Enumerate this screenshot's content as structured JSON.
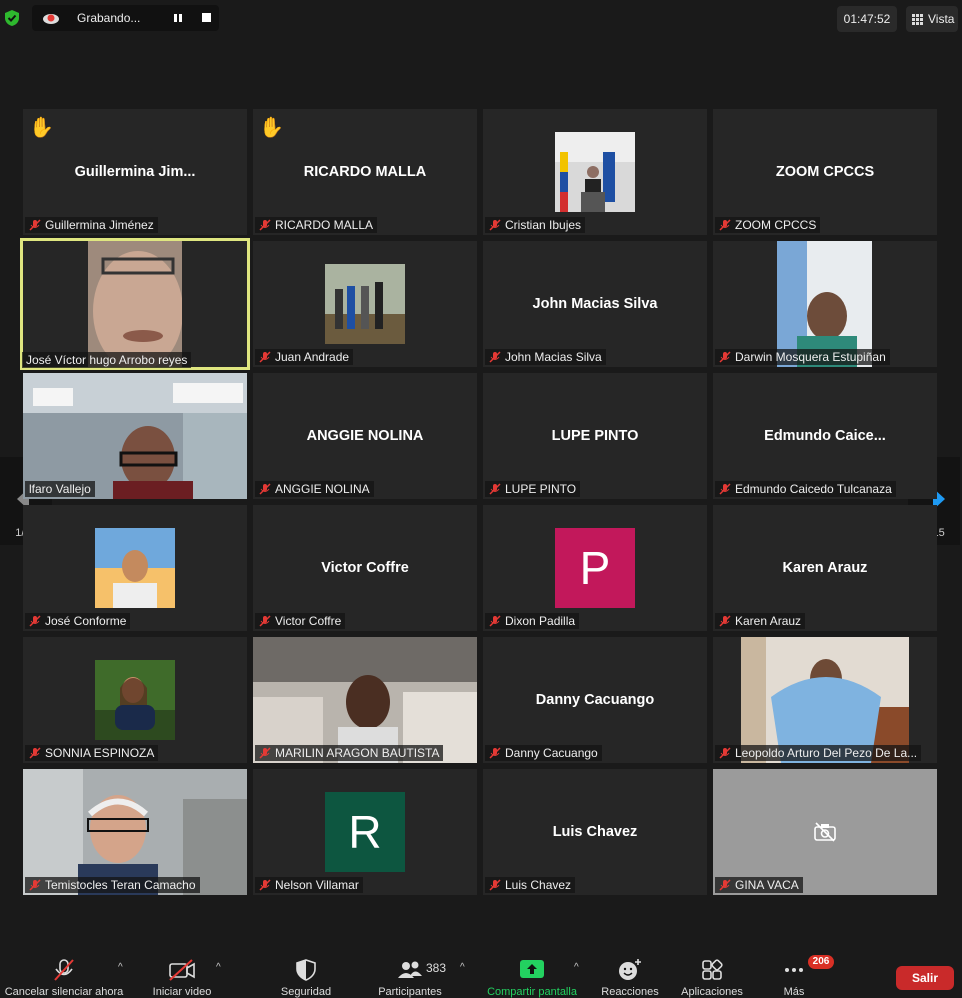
{
  "topbar": {
    "recording_label": "Grabando...",
    "timer": "01:47:52",
    "view_label": "Vista"
  },
  "colors": {
    "active_speaker_border": "#dfe680",
    "avatar_p": "#c2185b",
    "avatar_r": "#0d5640",
    "leave_button": "#c92a2a",
    "share_green": "#23d160",
    "pager_arrow": "#1e9af3"
  },
  "pager": {
    "left_page": "1/15",
    "right_page": "1/15"
  },
  "participants": [
    {
      "name": "Guillermina Jiménez",
      "display": "Guillermina  Jim...",
      "hand": true
    },
    {
      "name": "RICARDO MALLA",
      "display": "RICARDO MALLA",
      "hand": true
    },
    {
      "name": "Cristian Ibujes"
    },
    {
      "name": "ZOOM CPCCS",
      "display": "ZOOM CPCCS"
    },
    {
      "name": "José Víctor hugo Arrobo reyes"
    },
    {
      "name": "Juan Andrade"
    },
    {
      "name": "John Macias Silva",
      "display": "John Macias Silva"
    },
    {
      "name": "Darwin Mosquera Estupiñan"
    },
    {
      "name": "lfaro Vallejo"
    },
    {
      "name": "ANGGIE NOLINA",
      "display": "ANGGIE NOLINA"
    },
    {
      "name": "LUPE PINTO",
      "display": "LUPE PINTO"
    },
    {
      "name": "Edmundo Caicedo Tulcanaza",
      "display": "Edmundo  Caice..."
    },
    {
      "name": "José Conforme"
    },
    {
      "name": "Victor Coffre",
      "display": "Victor Coffre"
    },
    {
      "name": "Dixon Padilla",
      "avatar": "P"
    },
    {
      "name": "Karen Arauz",
      "display": "Karen Arauz"
    },
    {
      "name": "SONNIA ESPINOZA"
    },
    {
      "name": "MARILIN ARAGON BAUTISTA"
    },
    {
      "name": "Danny Cacuango",
      "display": "Danny Cacuango"
    },
    {
      "name": "Leopoldo Arturo Del Pezo De La..."
    },
    {
      "name": "Temistocles Teran Camacho"
    },
    {
      "name": "Nelson Villamar",
      "avatar": "R"
    },
    {
      "name": "Luis Chavez",
      "display": "Luis Chavez"
    },
    {
      "name": "GINA VACA"
    }
  ],
  "toolbar": {
    "mute_label": "Cancelar silenciar ahora",
    "video_label": "Iniciar video",
    "security_label": "Seguridad",
    "participants_label": "Participantes",
    "participants_count": "383",
    "share_label": "Compartir pantalla",
    "reactions_label": "Reacciones",
    "apps_label": "Aplicaciones",
    "more_label": "Más",
    "more_badge": "206",
    "leave_label": "Salir"
  }
}
